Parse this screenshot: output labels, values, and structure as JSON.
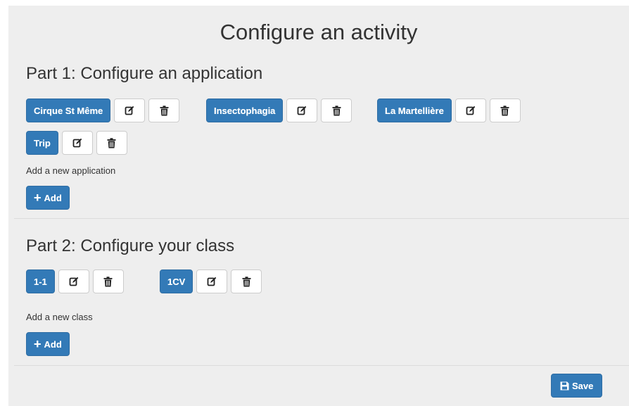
{
  "page": {
    "title": "Configure an activity"
  },
  "part1": {
    "heading": "Part 1: Configure an application",
    "applications": [
      "Cirque St Même",
      "Insectophagia",
      "La Martellière",
      "Trip"
    ],
    "add_hint": "Add a new application",
    "add_label": "Add"
  },
  "part2": {
    "heading": "Part 2: Configure your class",
    "classes": [
      "1-1",
      "1CV"
    ],
    "add_hint": "Add a new class",
    "add_label": "Add"
  },
  "footer": {
    "save_label": "Save"
  },
  "colors": {
    "primary": "#337ab7",
    "panel": "#eeeeee",
    "text": "#333333"
  },
  "icons": {
    "edit": "edit-icon",
    "delete": "trash-icon",
    "add": "plus-icon",
    "save": "floppy-disk-icon"
  }
}
